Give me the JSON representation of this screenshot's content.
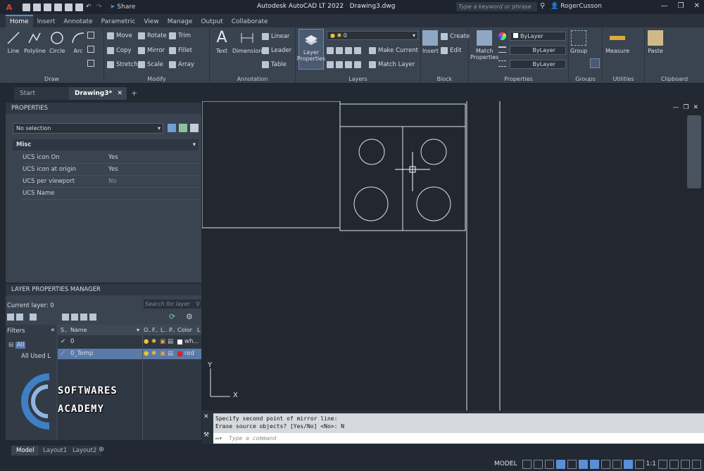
{
  "titlebar": {
    "app_logo": "A",
    "share": "Share",
    "title_app": "Autodesk AutoCAD LT 2022",
    "title_file": "Drawing3.dwg",
    "search_placeholder": "Type a keyword or phrase",
    "user": "RogerCusson"
  },
  "ribbon_tabs": [
    "Home",
    "Insert",
    "Annotate",
    "Parametric",
    "View",
    "Manage",
    "Output",
    "Collaborate"
  ],
  "ribbon": {
    "draw": {
      "name": "Draw",
      "line": "Line",
      "polyline": "Polyline",
      "circle": "Circle",
      "arc": "Arc"
    },
    "modify": {
      "name": "Modify",
      "move": "Move",
      "rotate": "Rotate",
      "trim": "Trim",
      "copy": "Copy",
      "mirror": "Mirror",
      "fillet": "Fillet",
      "stretch": "Stretch",
      "scale": "Scale",
      "array": "Array"
    },
    "annotation": {
      "name": "Annotation",
      "text": "Text",
      "dimension": "Dimension",
      "linear": "Linear",
      "leader": "Leader",
      "table": "Table"
    },
    "layers": {
      "name": "Layers",
      "layer_properties_1": "Layer",
      "layer_properties_2": "Properties",
      "current_layer": "0",
      "make_current": "Make Current",
      "match_layer": "Match Layer"
    },
    "block": {
      "name": "Block",
      "insert": "Insert",
      "create": "Create",
      "edit": "Edit"
    },
    "properties": {
      "name": "Properties",
      "match_1": "Match",
      "match_2": "Properties",
      "bylayer_color": "ByLayer",
      "bylayer_lineweight": "ByLayer",
      "bylayer_linetype": "ByLayer"
    },
    "groups": {
      "name": "Groups",
      "group": "Group"
    },
    "utilities": {
      "name": "Utilities",
      "measure": "Measure"
    },
    "clipboard": {
      "name": "Clipboard",
      "paste": "Paste"
    }
  },
  "doc_tabs": {
    "start": "Start",
    "drawing": "Drawing3*"
  },
  "properties_panel": {
    "title": "PROPERTIES",
    "selection": "No selection",
    "section": "Misc",
    "rows": [
      {
        "label": "UCS icon On",
        "value": "Yes"
      },
      {
        "label": "UCS icon at origin",
        "value": "Yes"
      },
      {
        "label": "UCS per viewport",
        "value": "No"
      },
      {
        "label": "UCS Name",
        "value": ""
      }
    ]
  },
  "layer_manager": {
    "title": "LAYER PROPERTIES MANAGER",
    "current_layer": "Current layer: 0",
    "search_placeholder": "Search for layer",
    "filters_label": "Filters",
    "filter_all": "All",
    "filter_used": "All Used L",
    "col_status": "S..",
    "col_name": "Name",
    "col_on": "O..",
    "col_freeze": "F..",
    "col_lock": "L..",
    "col_plot": "P..",
    "col_color": "Color",
    "col_l": "L",
    "layers": [
      {
        "name": "0",
        "color_name": "wh...",
        "color": "#ffffff"
      },
      {
        "name": "0_Temp",
        "color_name": "red",
        "color": "#e02020"
      }
    ]
  },
  "command": {
    "line1": "Specify second point of mirror line:",
    "line2": "Erase source objects? [Yes/No] <No>: N",
    "placeholder": "Type a command"
  },
  "ucs": {
    "x": "X",
    "y": "Y"
  },
  "layout_tabs": [
    "Model",
    "Layout1",
    "Layout2"
  ],
  "status": {
    "model": "MODEL",
    "scale": "1:1"
  },
  "watermark": {
    "line1": "SOFTWARES",
    "line2": "ACADEMY"
  },
  "colors": {
    "accent": "#4a90d9",
    "canvas": "#212830",
    "panel": "#3a4350"
  }
}
